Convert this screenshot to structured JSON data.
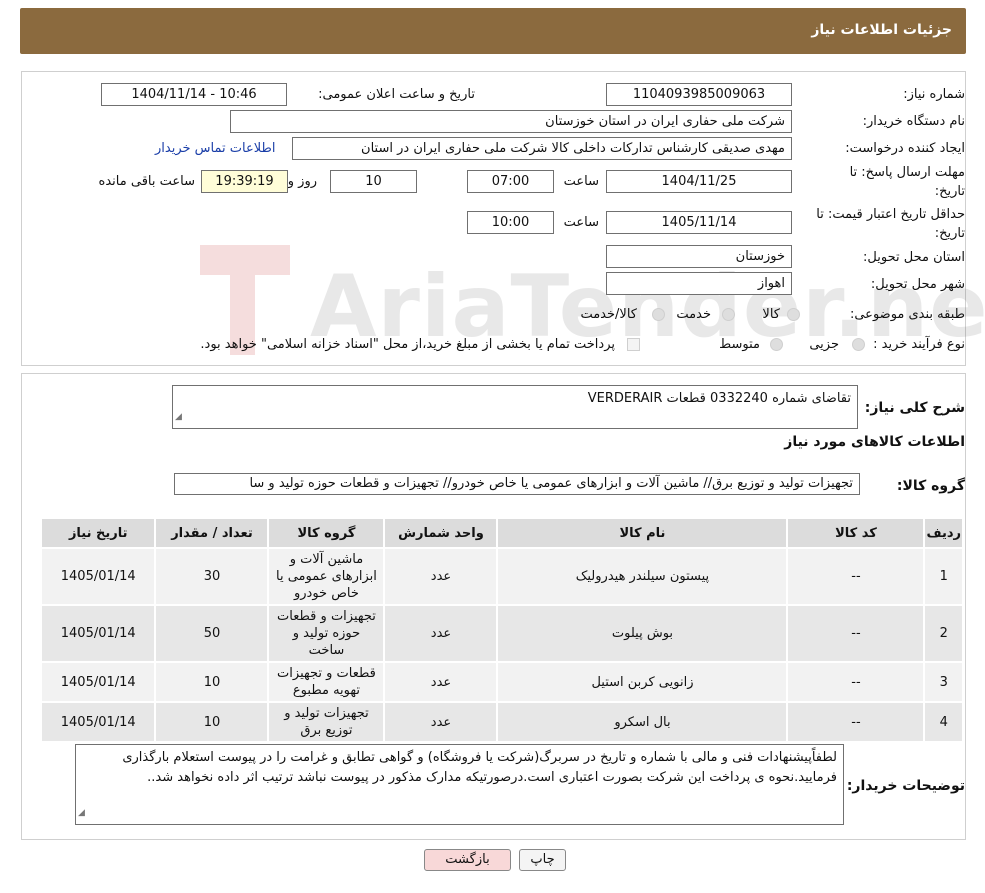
{
  "header": {
    "title": "جزئیات اطلاعات نیاز"
  },
  "fields": {
    "need_number_label": "شماره نیاز:",
    "need_number": "1104093985009063",
    "announce_label": "تاریخ و ساعت اعلان عمومی:",
    "announce_value": "1404/11/14 - 10:46",
    "buyer_org_label": "نام دستگاه خریدار:",
    "buyer_org": "شرکت ملی حفاری ایران در استان خوزستان",
    "creator_label": "ایجاد کننده درخواست:",
    "creator": "مهدی صدیقی کارشناس تدارکات داخلی کالا شرکت ملی حفاری ایران در استان",
    "contact_link": "اطلاعات تماس خریدار",
    "deadline_label_1": "مهلت ارسال پاسخ: تا",
    "deadline_label_2": "تاریخ:",
    "deadline_date": "1404/11/25",
    "time_label": "ساعت",
    "deadline_time": "07:00",
    "days_value": "10",
    "days_label": "روز و",
    "remaining_time": "19:39:19",
    "remaining_label": "ساعت باقی مانده",
    "validity_label_1": "حداقل تاریخ اعتبار قیمت: تا",
    "validity_label_2": "تاریخ:",
    "validity_date": "1405/11/14",
    "validity_time": "10:00",
    "province_label": "استان محل تحویل:",
    "province": "خوزستان",
    "city_label": "شهر محل تحویل:",
    "city": "اهواز",
    "category_label": "طبقه بندی موضوعی:",
    "category_options": [
      "کالا",
      "خدمت",
      "کالا/خدمت"
    ],
    "process_label": "نوع فرآیند خرید :",
    "process_options": [
      "جزیی",
      "متوسط"
    ],
    "payment_note": "پرداخت تمام یا بخشی از مبلغ خرید،از محل \"اسناد خزانه اسلامی\" خواهد بود."
  },
  "description": {
    "label": "شرح کلی نیاز:",
    "value": "تقاضای شماره 0332240 قطعات VERDERAIR"
  },
  "goods": {
    "section_title": "اطلاعات کالاهای مورد نیاز",
    "group_label": "گروه کالا:",
    "group_value": "تجهیزات تولید و توزیع برق//  ماشین آلات و ابزارهای عمومی یا خاص خودرو// تجهیزات و قطعات حوزه تولید و سا"
  },
  "table": {
    "headers": [
      "ردیف",
      "کد کالا",
      "نام کالا",
      "واحد شمارش",
      "گروه کالا",
      "تعداد / مقدار",
      "تاریخ نیاز"
    ],
    "rows": [
      [
        "1",
        "--",
        "پیستون سیلندر هیدرولیک",
        "عدد",
        "ماشین آلات و ابزارهای عمومی یا خاص خودرو",
        "30",
        "1405/01/14"
      ],
      [
        "2",
        "--",
        "بوش پیلوت",
        "عدد",
        "تجهیزات و قطعات حوزه تولید و ساخت",
        "50",
        "1405/01/14"
      ],
      [
        "3",
        "--",
        "زانویی کربن استیل",
        "عدد",
        "قطعات و تجهیزات تهویه مطبوع",
        "10",
        "1405/01/14"
      ],
      [
        "4",
        "--",
        "بال اسکرو",
        "عدد",
        "تجهیزات تولید و توزیع برق",
        "10",
        "1405/01/14"
      ]
    ]
  },
  "buyer_notes": {
    "label": "توضیحات خریدار:",
    "value": "لطفاًپیشنهادات فنی و مالی با شماره و تاریخ در سربرگ(شرکت یا فروشگاه) و گواهی تطابق و غرامت را در پیوست استعلام بارگذاری فرمایید.نحوه ی پرداخت این شرکت بصورت اعتباری است.درصورتیکه مدارک مذکور در پیوست نباشد ترتیب اثر داده نخواهد شد.."
  },
  "buttons": {
    "print": "چاپ",
    "back": "بازگشت"
  },
  "watermark": {
    "text": "AriaTender.neT"
  },
  "colors": {
    "header_bg": "#8b6a3e",
    "link": "#1a3ea8",
    "timer_bg": "#fffdd8",
    "back_btn_bg": "#f8d8d8"
  }
}
